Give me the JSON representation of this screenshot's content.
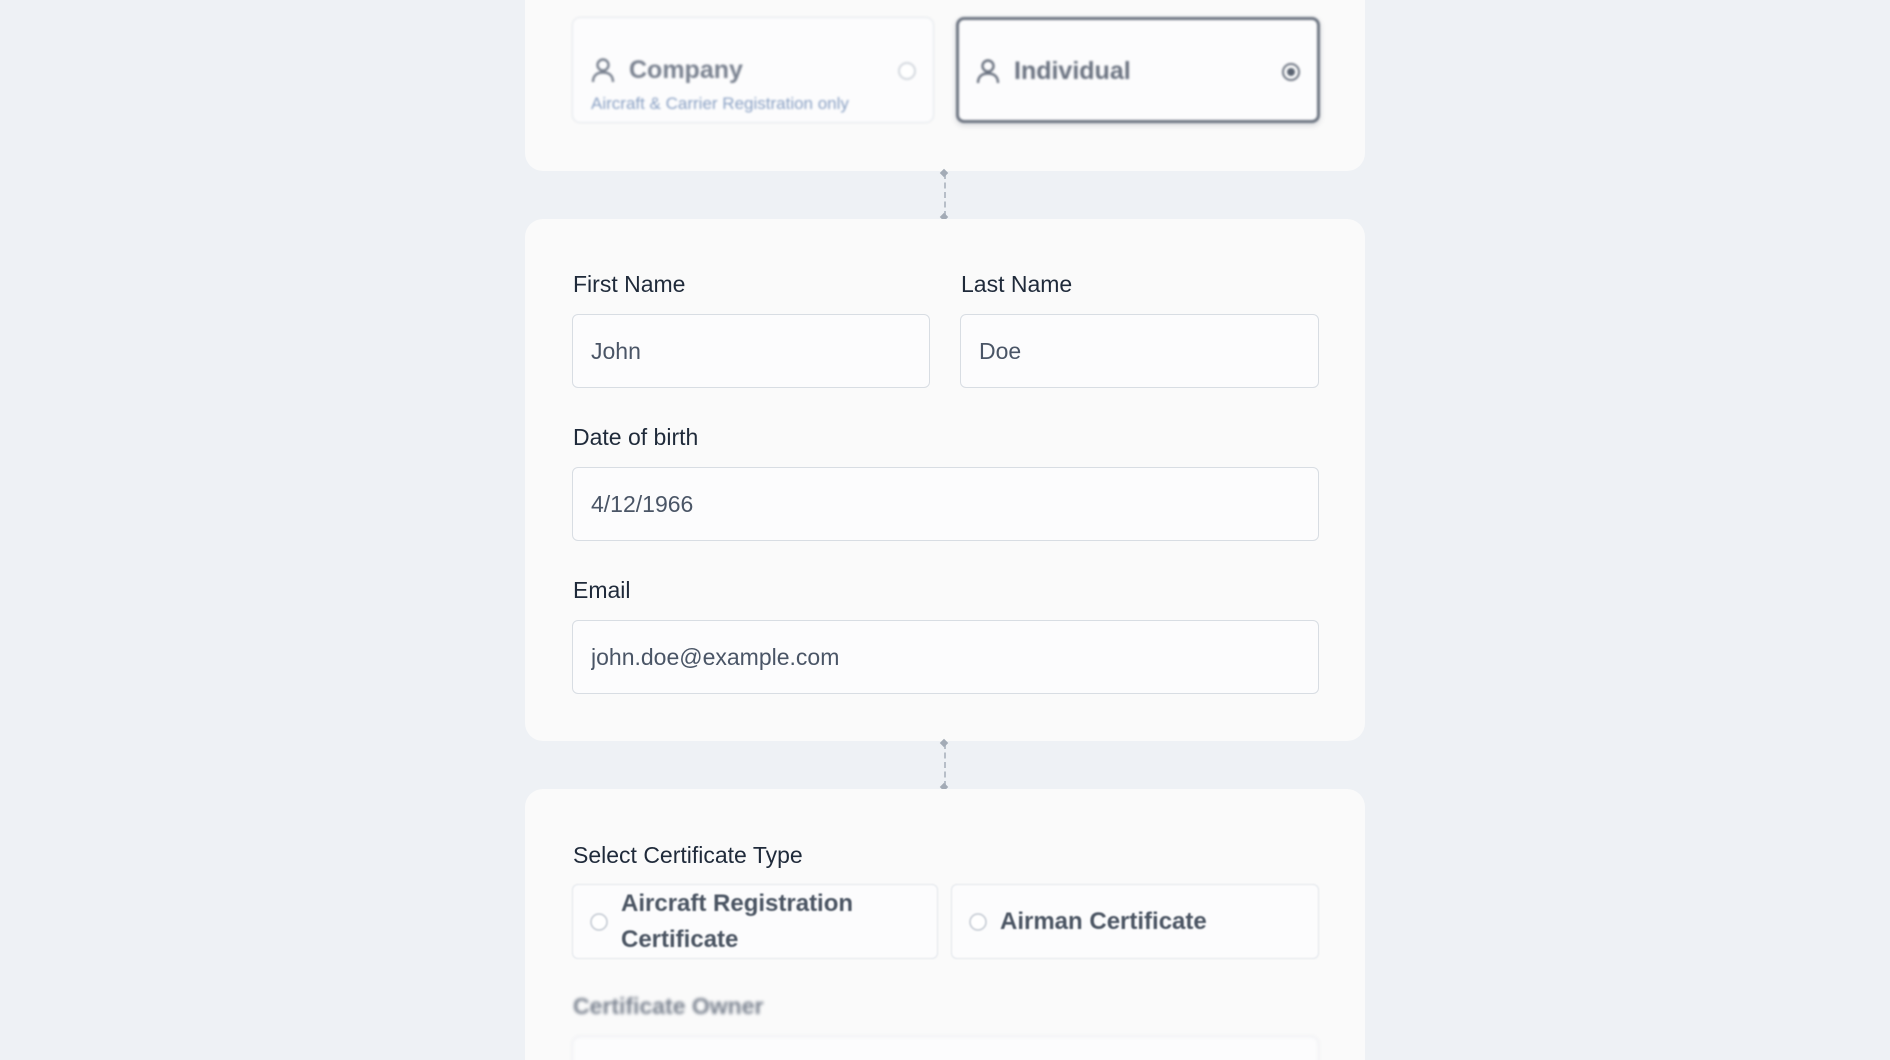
{
  "account_type": {
    "options": [
      {
        "title": "Company",
        "subtitle": "Aircraft & Carrier Registration only",
        "icon": "user-icon",
        "selected": false
      },
      {
        "title": "Individual",
        "subtitle": "",
        "icon": "user-icon",
        "selected": true
      }
    ]
  },
  "person": {
    "first_name_label": "First Name",
    "first_name_value": "John",
    "last_name_label": "Last Name",
    "last_name_value": "Doe",
    "dob_label": "Date of birth",
    "dob_value": "4/12/1966",
    "email_label": "Email",
    "email_value": "john.doe@example.com"
  },
  "certificate": {
    "type_label": "Select Certificate Type",
    "options": [
      {
        "label": "Aircraft Registration Certificate",
        "selected": false
      },
      {
        "label": "Airman Certificate",
        "selected": false
      }
    ],
    "owner_label": "Certificate Owner"
  },
  "colors": {
    "page_bg": "#eef1f5",
    "card_bg": "#fafafa",
    "selected_border": "#6b7380",
    "subtitle_blue": "#8aa1c4"
  }
}
